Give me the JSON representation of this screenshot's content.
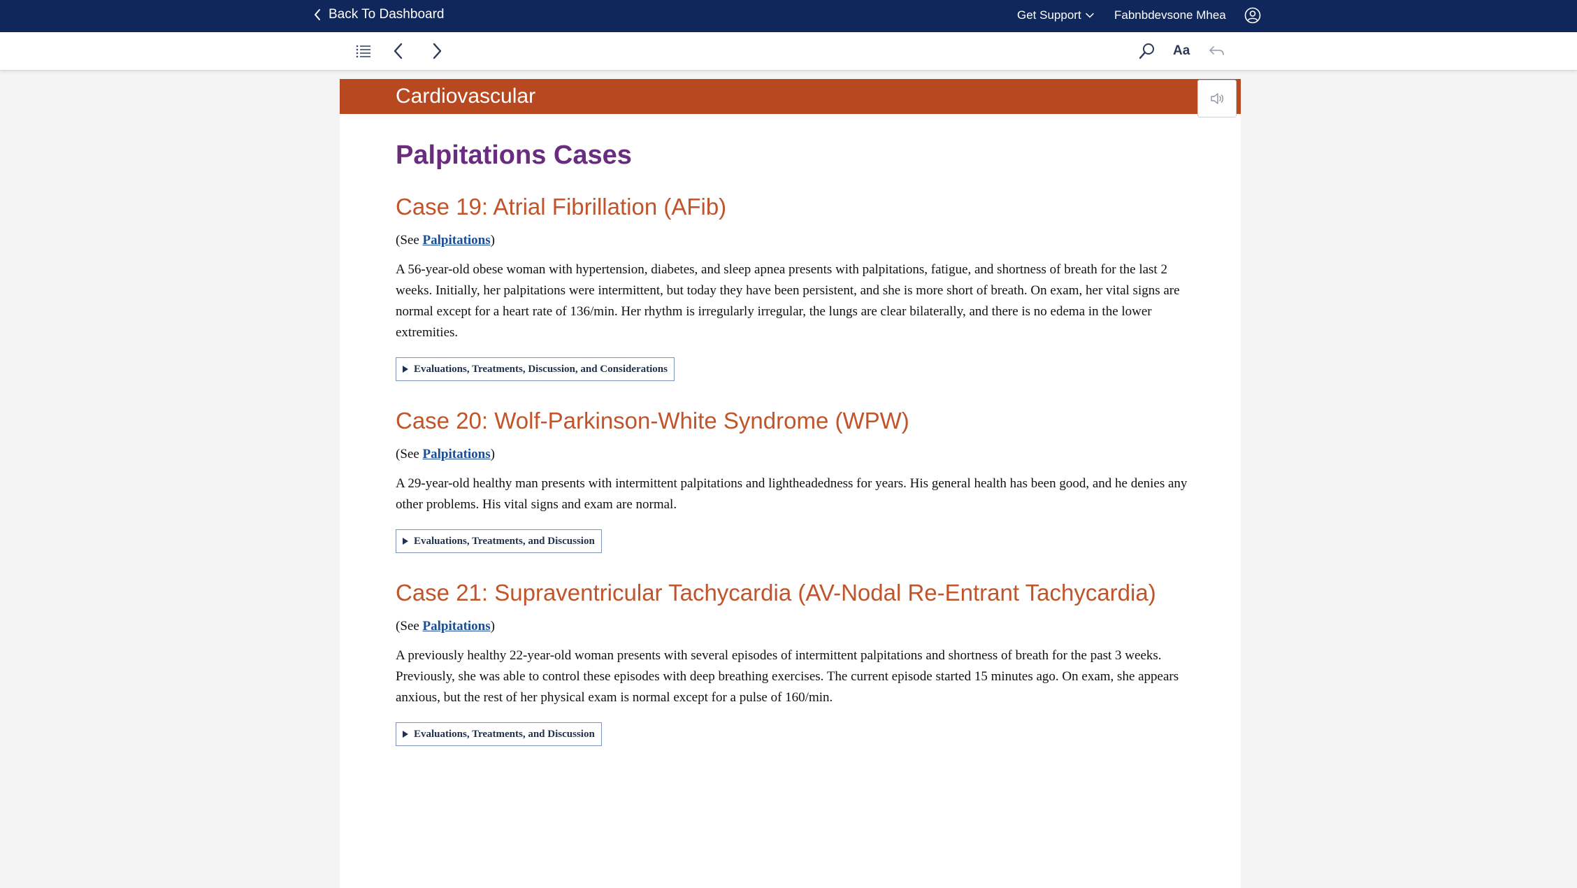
{
  "topbar": {
    "back_label": "Back To Dashboard",
    "support_label": "Get Support",
    "username": "Fabnbdevsone Mhea"
  },
  "toolbar": {
    "icons": [
      "list-icon",
      "prev-arrow-icon",
      "next-arrow-icon",
      "search-icon",
      "undo-arrow-icon"
    ],
    "font_size_label": "Aa"
  },
  "chapter": {
    "title": "Cardiovascular",
    "color": "#b84820"
  },
  "page": {
    "title": "Palpitations Cases"
  },
  "cases": [
    {
      "title": "Case 19: Atrial Fibrillation (AFib)",
      "see_prefix": "(See ",
      "see_link": "Palpitations",
      "see_suffix": ")",
      "text": "A 56-year-old obese woman with hypertension, diabetes, and sleep apnea presents with palpitations, fatigue, and shortness of breath for the last 2 weeks. Initially, her palpitations were intermittent, but today they have been persistent, and she is more short of breath. On exam, her vital signs are normal except for a heart rate of 136/min. Her rhythm is irregularly irregular, the lungs are clear bilaterally, and there is no edema in the lower extremities.",
      "details_label": "Evaluations, Treatments, Discussion, and Considerations"
    },
    {
      "title": "Case 20: Wolf-Parkinson-White Syndrome (WPW)",
      "see_prefix": "(See ",
      "see_link": "Palpitations",
      "see_suffix": ")",
      "text": "A 29-year-old healthy man presents with intermittent palpitations and lightheadedness for years. His general health has been good, and he denies any other problems. His vital signs and exam are normal.",
      "details_label": "Evaluations, Treatments, and Discussion"
    },
    {
      "title": "Case 21: Supraventricular Tachycardia (AV-Nodal Re-Entrant Tachycardia)",
      "see_prefix": "(See ",
      "see_link": "Palpitations",
      "see_suffix": ")",
      "text": "A previously healthy 22-year-old woman presents with several episodes of intermittent palpitations and shortness of breath for the past 3 weeks. Previously, she was able to control these episodes with deep breathing exercises. The current episode started 15 minutes ago. On exam, she appears anxious, but the rest of her physical exam is normal except for a pulse of 160/min.",
      "details_label": "Evaluations, Treatments, and Discussion"
    }
  ]
}
